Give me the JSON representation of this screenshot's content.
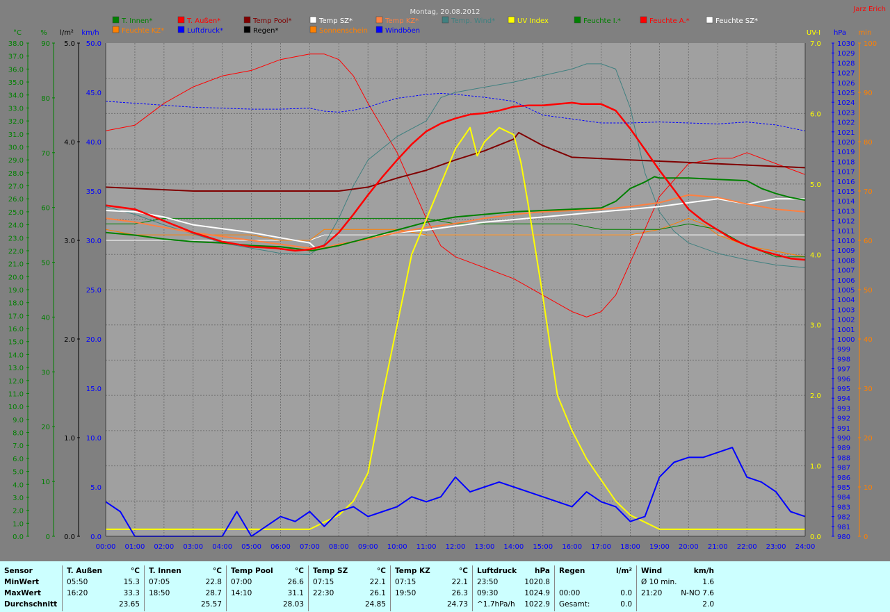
{
  "title": "Montag, 20.08.2012",
  "author": "Jarz Erich",
  "colors": {
    "t_innen": "#008000",
    "t_aussen": "#ff0000",
    "temp_pool": "#800000",
    "temp_sz": "#ffffff",
    "temp_kz": "#ff8040",
    "temp_wind": "#408080",
    "uv": "#ffff00",
    "feuchte_i": "#008000",
    "feuchte_a": "#ff0000",
    "feuchte_sz": "#ffffff",
    "feuchte_kz": "#ff8000",
    "luftdruck": "#0000ff",
    "regen": "#000000",
    "sonnenschein": "#ff8000",
    "windboeen": "#0000ff"
  },
  "legend": [
    {
      "label": "T. Innen*",
      "color": "#008000"
    },
    {
      "label": "T. Außen*",
      "color": "#ff0000"
    },
    {
      "label": "Temp Pool*",
      "color": "#800000"
    },
    {
      "label": "Temp SZ*",
      "color": "#ffffff"
    },
    {
      "label": "Temp KZ*",
      "color": "#ff8040"
    },
    {
      "label": "Temp. Wind*",
      "color": "#408080"
    },
    {
      "label": "UV Index",
      "color": "#ffff00"
    },
    {
      "label": "Feuchte I.*",
      "color": "#008000"
    },
    {
      "label": "Feuchte A.*",
      "color": "#ff0000"
    },
    {
      "label": "Feuchte SZ*",
      "color": "#ffffff"
    },
    {
      "label": "Feuchte KZ*",
      "color": "#ff8000"
    },
    {
      "label": "Luftdruck*",
      "color": "#0000ff"
    },
    {
      "label": "Regen*",
      "color": "#000000"
    },
    {
      "label": "Sonnenschein",
      "color": "#ff8000"
    },
    {
      "label": "Windböen",
      "color": "#0000ff"
    }
  ],
  "axes": {
    "temp_unit": "°C",
    "hum_unit": "%",
    "rain_unit": "l/m²",
    "wind_unit": "km/h",
    "uv_unit": "UV-I",
    "press_unit": "hPa",
    "sun_unit": "min",
    "temp_ticks": [
      "38.0",
      "37.0",
      "36.0",
      "35.0",
      "34.0",
      "33.0",
      "32.0",
      "31.0",
      "30.0",
      "29.0",
      "28.0",
      "27.0",
      "26.0",
      "25.0",
      "24.0",
      "23.0",
      "22.0",
      "21.0",
      "20.0",
      "19.0",
      "18.0",
      "17.0",
      "16.0",
      "15.0",
      "14.0",
      "13.0",
      "12.0",
      "11.0",
      "10.0",
      "9.0",
      "8.0",
      "7.0",
      "6.0",
      "5.0",
      "4.0",
      "3.0",
      "2.0",
      "1.0",
      "0.0"
    ],
    "hum_ticks": [
      "90",
      "80",
      "70",
      "60",
      "50",
      "40",
      "30",
      "20",
      "10",
      "0"
    ],
    "rain_ticks": [
      "5.0",
      "4.0",
      "3.0",
      "2.0",
      "1.0",
      "0.0"
    ],
    "wind_ticks": [
      "50.0",
      "45.0",
      "40.0",
      "35.0",
      "30.0",
      "25.0",
      "20.0",
      "15.0",
      "10.0",
      "5.0",
      "0.0"
    ],
    "uv_ticks": [
      "7.0",
      "6.0",
      "5.0",
      "4.0",
      "3.0",
      "2.0",
      "1.0",
      "0.0"
    ],
    "press_ticks": [
      "1030",
      "1029",
      "1028",
      "1027",
      "1026",
      "1025",
      "1024",
      "1023",
      "1022",
      "1021",
      "1020",
      "1019",
      "1018",
      "1017",
      "1016",
      "1015",
      "1014",
      "1013",
      "1012",
      "1011",
      "1010",
      "1009",
      "1008",
      "1007",
      "1006",
      "1005",
      "1004",
      "1003",
      "1002",
      "1001",
      "1000",
      "999",
      "998",
      "997",
      "996",
      "995",
      "994",
      "993",
      "992",
      "991",
      "990",
      "989",
      "988",
      "987",
      "986",
      "985",
      "984",
      "983",
      "982",
      "981",
      "980"
    ],
    "sun_ticks": [
      "100",
      "90",
      "80",
      "70",
      "60",
      "50",
      "40",
      "30",
      "20",
      "10",
      "0"
    ],
    "time_ticks": [
      "00:00",
      "01:00",
      "02:00",
      "03:00",
      "04:00",
      "05:00",
      "06:00",
      "07:00",
      "08:00",
      "09:00",
      "10:00",
      "11:00",
      "12:00",
      "13:00",
      "14:00",
      "15:00",
      "16:00",
      "17:00",
      "18:00",
      "19:00",
      "20:00",
      "21:00",
      "22:00",
      "23:00",
      "24:00"
    ]
  },
  "chart_data": {
    "type": "line",
    "title": "Montag, 20.08.2012",
    "xlabel": "",
    "x_unit": "hour",
    "xlim": [
      0,
      24
    ],
    "ylim_temp": [
      0,
      38
    ],
    "ylim_humidity": [
      0,
      90
    ],
    "ylim_wind": [
      0,
      50
    ],
    "ylim_uv": [
      0,
      7
    ],
    "ylim_pressure": [
      980,
      1030
    ],
    "grid": true,
    "series": [
      {
        "name": "T. Außen*",
        "axis": "temp",
        "x": [
          0,
          1,
          2,
          3,
          4,
          5,
          5.83,
          6.5,
          7,
          7.5,
          8,
          8.5,
          9,
          9.5,
          10,
          10.5,
          11,
          11.5,
          12,
          12.5,
          13,
          13.5,
          14,
          14.5,
          15,
          15.5,
          16,
          16.33,
          16.5,
          17,
          17.5,
          18,
          18.5,
          19,
          19.5,
          20,
          20.5,
          21,
          21.5,
          22,
          22.5,
          23,
          23.5,
          24
        ],
        "y": [
          25.5,
          25.2,
          24.3,
          23.4,
          22.7,
          22.3,
          22.2,
          22.0,
          22.1,
          22.4,
          23.4,
          24.8,
          26.3,
          27.7,
          29.0,
          30.2,
          31.2,
          31.8,
          32.2,
          32.5,
          32.6,
          32.8,
          33.1,
          33.2,
          33.2,
          33.3,
          33.4,
          33.3,
          33.3,
          33.3,
          32.8,
          31.4,
          29.8,
          28.2,
          26.7,
          25.2,
          24.3,
          23.6,
          22.9,
          22.4,
          22.0,
          21.7,
          21.4,
          21.3
        ]
      },
      {
        "name": "T. Innen*",
        "axis": "temp",
        "x": [
          0,
          1,
          2,
          3,
          4,
          5,
          6,
          7.08,
          8,
          9,
          10,
          11,
          12,
          13,
          14,
          15,
          16,
          17,
          17.5,
          18,
          18.5,
          18.83,
          19,
          20,
          21,
          22,
          22.5,
          23,
          23.5,
          24
        ],
        "y": [
          23.4,
          23.2,
          22.9,
          22.7,
          22.6,
          22.4,
          22.3,
          22.0,
          22.4,
          23.0,
          23.6,
          24.2,
          24.6,
          24.8,
          25.0,
          25.1,
          25.2,
          25.3,
          25.8,
          26.8,
          27.3,
          27.7,
          27.6,
          27.6,
          27.5,
          27.4,
          26.8,
          26.4,
          26.1,
          25.9
        ]
      },
      {
        "name": "Temp Pool*",
        "axis": "temp",
        "x": [
          0,
          1,
          2,
          3,
          4,
          5,
          6,
          7,
          8,
          9,
          10,
          11,
          12,
          13,
          14,
          14.17,
          15,
          16,
          17,
          18,
          19,
          20,
          21,
          22,
          23,
          24
        ],
        "y": [
          26.9,
          26.8,
          26.7,
          26.6,
          26.6,
          26.6,
          26.6,
          26.6,
          26.6,
          26.9,
          27.6,
          28.2,
          29.0,
          29.7,
          30.6,
          31.1,
          30.1,
          29.2,
          29.1,
          29.0,
          28.9,
          28.8,
          28.7,
          28.6,
          28.5,
          28.4
        ]
      },
      {
        "name": "Temp SZ*",
        "axis": "temp",
        "x": [
          0,
          1,
          2,
          3,
          4,
          5,
          6,
          7,
          7.25,
          8,
          9,
          10,
          11,
          12,
          13,
          14,
          15,
          16,
          17,
          18,
          19,
          20,
          21,
          21.5,
          22,
          22.5,
          23,
          23.5,
          24
        ],
        "y": [
          25.1,
          25.0,
          24.6,
          24.0,
          23.7,
          23.4,
          23.0,
          22.6,
          22.1,
          22.4,
          23.0,
          23.4,
          23.6,
          23.9,
          24.2,
          24.4,
          24.6,
          24.8,
          25.0,
          25.2,
          25.4,
          25.7,
          26.0,
          25.8,
          25.6,
          25.8,
          26.0,
          26.0,
          26.0
        ]
      },
      {
        "name": "Temp KZ*",
        "axis": "temp",
        "x": [
          0,
          1,
          2,
          3,
          4,
          5,
          6,
          7,
          7.25,
          8,
          9,
          10,
          11,
          12,
          13,
          14,
          15,
          16,
          17,
          18,
          19,
          19.83,
          20,
          21,
          22,
          23,
          24
        ],
        "y": [
          24.5,
          24.2,
          23.8,
          23.4,
          23.1,
          22.8,
          22.5,
          22.2,
          22.1,
          22.5,
          22.9,
          23.4,
          23.8,
          24.1,
          24.5,
          24.8,
          25.0,
          25.1,
          25.2,
          25.4,
          25.7,
          26.2,
          26.3,
          26.1,
          25.6,
          25.2,
          25.0
        ]
      },
      {
        "name": "Temp. Wind*",
        "axis": "temp",
        "x": [
          0,
          1,
          2,
          3,
          4,
          5,
          6,
          7,
          7.5,
          8,
          8.5,
          9,
          10,
          11,
          11.5,
          12,
          13,
          14,
          15,
          16,
          16.5,
          17,
          17.5,
          18,
          18.5,
          19,
          19.5,
          20,
          21,
          22,
          23,
          24
        ],
        "y": [
          25.4,
          24.8,
          24.0,
          23.3,
          22.6,
          22.2,
          21.8,
          21.7,
          22.5,
          24.5,
          27.0,
          29.0,
          30.8,
          32.0,
          33.8,
          34.2,
          34.6,
          35.0,
          35.5,
          36.0,
          36.4,
          36.4,
          36.0,
          33.0,
          28.0,
          25.0,
          23.5,
          22.6,
          21.8,
          21.3,
          20.9,
          20.7
        ]
      },
      {
        "name": "UV Index",
        "axis": "uv",
        "x": [
          0,
          7.0,
          7.5,
          8.0,
          8.5,
          9.0,
          9.5,
          10.0,
          10.5,
          11.0,
          11.5,
          12.0,
          12.5,
          12.75,
          13.0,
          13.5,
          14.0,
          14.25,
          14.5,
          15.0,
          15.5,
          16.0,
          16.5,
          17.0,
          17.5,
          18.0,
          18.5,
          19.0,
          24
        ],
        "y": [
          0.1,
          0.1,
          0.2,
          0.3,
          0.5,
          0.9,
          2.0,
          3.0,
          4.0,
          4.5,
          5.0,
          5.5,
          5.8,
          5.4,
          5.6,
          5.8,
          5.7,
          5.3,
          4.7,
          3.4,
          2.0,
          1.5,
          1.1,
          0.8,
          0.5,
          0.3,
          0.2,
          0.1,
          0.1
        ]
      },
      {
        "name": "Feuchte A.*",
        "axis": "humidity",
        "x": [
          0,
          1,
          2,
          3,
          4,
          5,
          6,
          7,
          7.5,
          8,
          8.5,
          9,
          10,
          11,
          11.5,
          12,
          13,
          14,
          15,
          16,
          16.5,
          17,
          17.5,
          18,
          18.5,
          19,
          20,
          21,
          21.5,
          22,
          23,
          24
        ],
        "y": [
          74,
          75,
          79,
          82,
          84,
          85,
          87,
          88,
          88,
          87,
          84,
          79,
          70,
          58,
          53,
          51,
          49,
          47,
          44,
          41,
          40,
          41,
          44,
          50,
          56,
          62,
          68,
          69,
          69,
          70,
          68,
          66
        ]
      },
      {
        "name": "Feuchte I.*",
        "axis": "humidity",
        "x": [
          0,
          1,
          2,
          3,
          4,
          5,
          6,
          7,
          8,
          9,
          10,
          11,
          12,
          13,
          14,
          15,
          16,
          17,
          18,
          19,
          20,
          21,
          22,
          23,
          24
        ],
        "y": [
          57,
          57,
          58,
          58,
          58,
          58,
          58,
          58,
          58,
          58,
          58,
          58,
          57,
          57,
          57,
          57,
          57,
          56,
          56,
          56,
          57,
          56,
          53,
          51,
          51
        ]
      },
      {
        "name": "Feuchte SZ*",
        "axis": "humidity",
        "x": [
          0,
          1,
          2,
          3,
          4,
          5,
          6,
          7,
          7.5,
          8,
          9,
          10,
          11,
          12,
          13,
          14,
          15,
          16,
          17,
          18,
          19,
          20,
          24
        ],
        "y": [
          54,
          54,
          54,
          54,
          54,
          54,
          54,
          54,
          55,
          55,
          55,
          55,
          55,
          55,
          55,
          55,
          55,
          55,
          55,
          55,
          55,
          55,
          55
        ]
      },
      {
        "name": "Feuchte KZ*",
        "axis": "humidity",
        "x": [
          0,
          1,
          2,
          3,
          4,
          5,
          6,
          7,
          7.5,
          8,
          9,
          10,
          11,
          12,
          13,
          14,
          15,
          16,
          17,
          18,
          19,
          19.5,
          20,
          20.5,
          21,
          21.5,
          22,
          23,
          24
        ],
        "y": [
          56,
          55,
          55,
          55,
          55,
          55,
          54,
          54,
          56,
          56,
          56,
          56,
          55,
          55,
          55,
          55,
          55,
          55,
          55,
          55,
          56,
          57,
          58,
          57,
          55,
          54,
          53,
          52,
          51
        ]
      },
      {
        "name": "Luftdruck*",
        "axis": "pressure",
        "x": [
          0,
          1,
          2,
          3,
          4,
          5,
          6,
          7,
          7.5,
          8,
          8.5,
          9,
          9.5,
          10,
          10.5,
          11,
          11.5,
          12,
          13,
          14,
          15,
          16,
          17,
          18,
          19,
          20,
          21,
          22,
          23,
          23.83,
          24
        ],
        "y": [
          1024.1,
          1023.9,
          1023.7,
          1023.5,
          1023.4,
          1023.3,
          1023.3,
          1023.4,
          1023.1,
          1023.0,
          1023.2,
          1023.5,
          1024.0,
          1024.4,
          1024.6,
          1024.8,
          1024.9,
          1024.8,
          1024.5,
          1024.1,
          1022.7,
          1022.3,
          1021.9,
          1021.9,
          1022.0,
          1021.9,
          1021.8,
          1022.0,
          1021.7,
          1021.2,
          1021.1
        ]
      },
      {
        "name": "Windböen",
        "axis": "wind",
        "x": [
          0,
          0.5,
          1,
          1.5,
          4,
          4.5,
          5,
          6,
          6.5,
          7,
          7.5,
          8,
          8.5,
          9,
          9.5,
          10,
          10.5,
          11,
          11.5,
          12,
          12.5,
          13,
          13.5,
          14,
          14.5,
          15,
          15.5,
          16,
          16.5,
          17,
          17.5,
          18,
          18.5,
          19,
          19.5,
          20,
          20.5,
          21,
          21.5,
          22,
          22.5,
          23,
          23.5,
          24
        ],
        "y": [
          3.5,
          2.5,
          0.0,
          0.0,
          0.0,
          2.5,
          0.0,
          2.0,
          1.5,
          2.5,
          1.0,
          2.5,
          3.0,
          2.0,
          2.5,
          3.0,
          4.0,
          3.5,
          4.0,
          6.0,
          4.5,
          5.0,
          5.5,
          5.0,
          4.5,
          4.0,
          3.5,
          3.0,
          4.5,
          3.5,
          3.0,
          1.5,
          2.0,
          6.0,
          7.5,
          8.0,
          8.0,
          8.5,
          9.0,
          6.0,
          5.5,
          4.5,
          2.5,
          2.0
        ]
      }
    ]
  },
  "stats": {
    "c0": {
      "h": "Sensor",
      "r1": "MinWert",
      "r2": "MaxWert",
      "r3": "Durchschnitt"
    },
    "c1": {
      "h": "T. Außen",
      "u": "°C",
      "r1a": "05:50",
      "r1b": "15.3",
      "r2a": "16:20",
      "r2b": "33.3",
      "r3b": "23.65"
    },
    "c2": {
      "h": "T. Innen",
      "u": "°C",
      "r1a": "07:05",
      "r1b": "22.8",
      "r2a": "18:50",
      "r2b": "28.7",
      "r3b": "25.57"
    },
    "c3": {
      "h": "Temp Pool",
      "u": "°C",
      "r1a": "07:00",
      "r1b": "26.6",
      "r2a": "14:10",
      "r2b": "31.1",
      "r3b": "28.03"
    },
    "c4": {
      "h": "Temp SZ",
      "u": "°C",
      "r1a": "07:15",
      "r1b": "22.1",
      "r2a": "22:30",
      "r2b": "26.1",
      "r3b": "24.85"
    },
    "c5": {
      "h": "Temp KZ",
      "u": "°C",
      "r1a": "07:15",
      "r1b": "22.1",
      "r2a": "19:50",
      "r2b": "26.3",
      "r3b": "24.73"
    },
    "c6": {
      "h": "Luftdruck",
      "u": "hPa",
      "r1a": "23:50",
      "r1b": "1020.8",
      "r2a": "09:30",
      "r2b": "1024.9",
      "r3a": "^1.7hPa/h",
      "r3b": "1022.9"
    },
    "c7": {
      "h": "Regen",
      "u": "l/m²",
      "r2a": "00:00",
      "r2b": "0.0",
      "r3a": "Gesamt:",
      "r3b": "0.0"
    },
    "c8": {
      "h": "Wind",
      "u": "km/h",
      "r1a": "Ø 10 min.",
      "r1b": "1.6",
      "r2a": "21:20",
      "r2b": "N-NO 7.6",
      "r3b": "2.0"
    }
  }
}
